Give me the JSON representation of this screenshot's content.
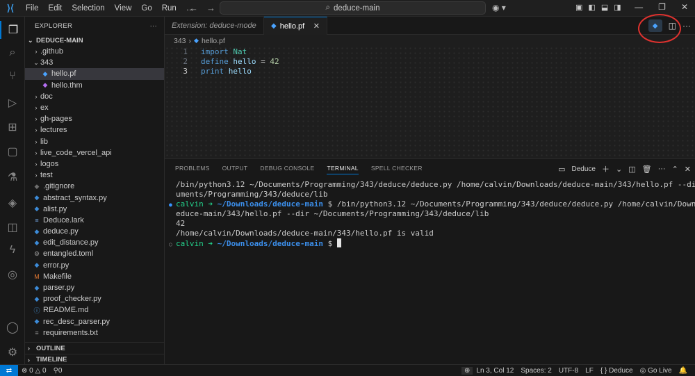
{
  "titlebar": {
    "menu": [
      "File",
      "Edit",
      "Selection",
      "View",
      "Go",
      "Run",
      "…"
    ],
    "search": "deduce-main"
  },
  "activity_icons": [
    "files-icon",
    "search-icon",
    "source-control-icon",
    "run-debug-icon",
    "extensions-icon",
    "remote-explorer-icon",
    "testing-icon",
    "docker-icon",
    "database-icon",
    "lightning-icon",
    "copilot-icon",
    "account-icon",
    "settings-icon"
  ],
  "sidebar": {
    "title": "EXPLORER",
    "folder": "DEDUCE-MAIN",
    "items": [
      {
        "label": ".github",
        "type": "folder",
        "indent": 1,
        "open": false
      },
      {
        "label": "343",
        "type": "folder",
        "indent": 1,
        "open": true
      },
      {
        "label": "hello.pf",
        "type": "pf",
        "indent": 2,
        "selected": true
      },
      {
        "label": "hello.thm",
        "type": "thm",
        "indent": 2
      },
      {
        "label": "doc",
        "type": "folder",
        "indent": 1
      },
      {
        "label": "ex",
        "type": "folder",
        "indent": 1
      },
      {
        "label": "gh-pages",
        "type": "folder",
        "indent": 1
      },
      {
        "label": "lectures",
        "type": "folder",
        "indent": 1
      },
      {
        "label": "lib",
        "type": "folder",
        "indent": 1
      },
      {
        "label": "live_code_vercel_api",
        "type": "folder",
        "indent": 1
      },
      {
        "label": "logos",
        "type": "folder",
        "indent": 1
      },
      {
        "label": "test",
        "type": "folder",
        "indent": 1
      },
      {
        "label": ".gitignore",
        "type": "gitignore",
        "indent": 1
      },
      {
        "label": "abstract_syntax.py",
        "type": "py",
        "indent": 1
      },
      {
        "label": "alist.py",
        "type": "py",
        "indent": 1
      },
      {
        "label": "Deduce.lark",
        "type": "lark",
        "indent": 1
      },
      {
        "label": "deduce.py",
        "type": "py",
        "indent": 1
      },
      {
        "label": "edit_distance.py",
        "type": "py",
        "indent": 1
      },
      {
        "label": "entangled.toml",
        "type": "toml",
        "indent": 1
      },
      {
        "label": "error.py",
        "type": "py",
        "indent": 1
      },
      {
        "label": "Makefile",
        "type": "make",
        "indent": 1
      },
      {
        "label": "parser.py",
        "type": "py",
        "indent": 1
      },
      {
        "label": "proof_checker.py",
        "type": "py",
        "indent": 1
      },
      {
        "label": "README.md",
        "type": "md",
        "indent": 1
      },
      {
        "label": "rec_desc_parser.py",
        "type": "py",
        "indent": 1
      },
      {
        "label": "requirements.txt",
        "type": "txt",
        "indent": 1
      }
    ],
    "outline": "OUTLINE",
    "timeline": "TIMELINE"
  },
  "tabs": [
    {
      "label": "Extension: deduce-mode",
      "active": false
    },
    {
      "label": "hello.pf",
      "active": true
    }
  ],
  "breadcrumb": [
    "343",
    "hello.pf"
  ],
  "editor": {
    "lines": [
      {
        "n": "1",
        "tokens": [
          [
            "kw",
            "import"
          ],
          [
            "op",
            " "
          ],
          [
            "typ",
            "Nat"
          ]
        ]
      },
      {
        "n": "2",
        "tokens": [
          [
            "kw",
            "define"
          ],
          [
            "op",
            " "
          ],
          [
            "id",
            "hello"
          ],
          [
            "op",
            " = "
          ],
          [
            "num",
            "42"
          ]
        ]
      },
      {
        "n": "3",
        "tokens": [
          [
            "kw",
            "print"
          ],
          [
            "op",
            " "
          ],
          [
            "id",
            "hello"
          ]
        ],
        "current": true
      }
    ]
  },
  "panel": {
    "tabs": [
      "PROBLEMS",
      "OUTPUT",
      "DEBUG CONSOLE",
      "TERMINAL",
      "SPELL CHECKER"
    ],
    "active_tab": "TERMINAL",
    "terminal_name": "Deduce",
    "lines": [
      {
        "text": "/bin/python3.12 ~/Documents/Programming/343/deduce/deduce.py /home/calvin/Downloads/deduce-main/343/hello.pf --dir ~/Doc"
      },
      {
        "text": "uments/Programming/343/deduce/lib"
      },
      {
        "prompt": true,
        "dot": "●",
        "user": "calvin",
        "arrow": " ➜ ",
        "path": "~/Downloads/deduce-main",
        "cmd": " $ /bin/python3.12 ~/Documents/Programming/343/deduce/deduce.py /home/calvin/Downloads/d"
      },
      {
        "text": "educe-main/343/hello.pf --dir ~/Documents/Programming/343/deduce/lib"
      },
      {
        "text": "42"
      },
      {
        "text": "/home/calvin/Downloads/deduce-main/343/hello.pf is valid"
      },
      {
        "prompt": true,
        "dot": "○",
        "user": "calvin",
        "arrow": " ➜ ",
        "path": "~/Downloads/deduce-main",
        "cmd": " $ ",
        "cursor": true
      }
    ]
  },
  "statusbar": {
    "remote": "⇄",
    "errors": "0",
    "warnings": "0",
    "ports": "0",
    "position": "Ln 3, Col 12",
    "spaces": "Spaces: 2",
    "encoding": "UTF-8",
    "eol": "LF",
    "language": "Deduce",
    "golive": "Go Live"
  }
}
